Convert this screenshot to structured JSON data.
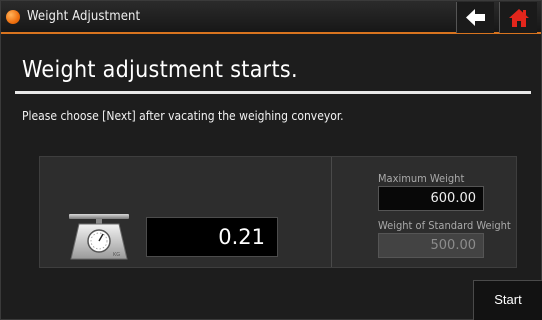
{
  "window": {
    "title": "Weight Adjustment",
    "accent_color": "#d8741f",
    "icons": {
      "status": "orange-dot-icon",
      "back": "back-arrow-icon",
      "home": "home-icon"
    }
  },
  "main": {
    "heading": "Weight adjustment starts.",
    "instruction": "Please choose [Next] after vacating the weighing conveyor."
  },
  "panel": {
    "scale_icon": "weighing-scale-icon",
    "current_value": "0.21",
    "maximum_weight": {
      "label": "Maximum Weight",
      "value": "600.00"
    },
    "standard_weight": {
      "label": "Weight of Standard Weight",
      "value": "500.00"
    }
  },
  "footer": {
    "start_label": "Start"
  }
}
